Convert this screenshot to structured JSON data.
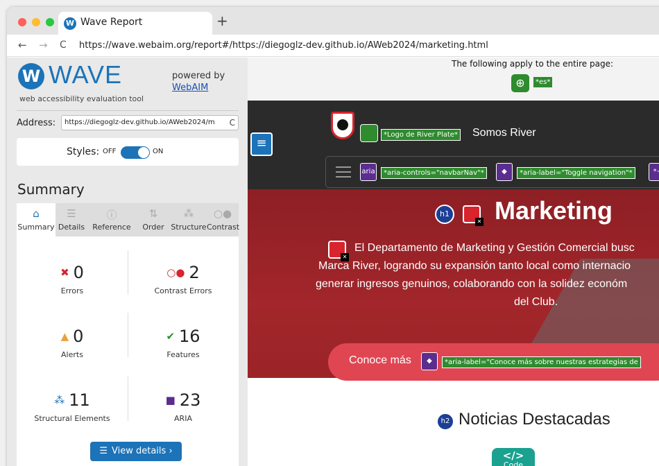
{
  "browser": {
    "tab_title": "Wave Report",
    "tab_icon_letter": "W",
    "new_tab": "+",
    "url": "https://wave.webaim.org/report#/https://diegoglz-dev.github.io/AWeb2024/marketing.html",
    "back": "←",
    "forward": "→",
    "reload": "C"
  },
  "sidebar": {
    "logo_letter": "W",
    "logo_text": "WAVE",
    "tagline": "web accessibility evaluation tool",
    "powered_by": "powered by",
    "powered_link": "WebAIM",
    "address_label": "Address:",
    "address_value": "https://diegoglz-dev.github.io/AWeb2024/m",
    "reload_icon": "C",
    "styles_label": "Styles:",
    "styles_off": "OFF",
    "styles_on": "ON",
    "summary_heading": "Summary",
    "tabs": [
      {
        "label": "Summary",
        "icon": "home-icon",
        "glyph": "⌂"
      },
      {
        "label": "Details",
        "icon": "list-icon",
        "glyph": "☰"
      },
      {
        "label": "Reference",
        "icon": "info-icon",
        "glyph": "ⓘ"
      },
      {
        "label": "Order",
        "icon": "order-icon",
        "glyph": "⇅"
      },
      {
        "label": "Structure",
        "icon": "structure-icon",
        "glyph": "⁂"
      },
      {
        "label": "Contrast",
        "icon": "contrast-icon",
        "glyph": "○●"
      }
    ],
    "counts": {
      "errors": {
        "value": "0",
        "label": "Errors",
        "symbol": "✖"
      },
      "contrast": {
        "value": "2",
        "label": "Contrast Errors",
        "symbol": "○●"
      },
      "alerts": {
        "value": "0",
        "label": "Alerts",
        "symbol": "▲"
      },
      "features": {
        "value": "16",
        "label": "Features",
        "symbol": "✔"
      },
      "structural": {
        "value": "11",
        "label": "Structural Elements",
        "symbol": "⁂"
      },
      "aria": {
        "value": "23",
        "label": "ARIA",
        "symbol": "■"
      }
    },
    "view_details": "View details ›"
  },
  "webpage": {
    "apply_text": "The following apply to the entire page:",
    "lang_tag": "*es*",
    "globe_glyph": "⊕",
    "logo_alt": "*Logo de River Plate*",
    "brand": "Somos River",
    "aria_badge": "aria",
    "aria_controls": "*aria-controls=\"navbarNav\"*",
    "aria_label_toggle": "*aria-label=\"Toggle navigation\"*",
    "aria_partial": "*+/",
    "h1_badge": "h1",
    "title": "Marketing",
    "paragraph_line1": "El Departamento de Marketing y Gestión Comercial busc",
    "paragraph_line2": "Marca River, logrando su expansión tanto local como internacio",
    "paragraph_line3": "generar ingresos genuinos, colaborando con la solidez económ",
    "paragraph_line4": "del Club.",
    "cta_text": "Conoce más",
    "cta_aria": "*aria-label=\"Conoce más sobre nuestras estrategias de",
    "h2_badge": "h2",
    "section_title": "Noticias Destacadas",
    "code_glyph": "</>",
    "code_label": "Code"
  },
  "colors": {
    "wave_blue": "#1c73b8",
    "feature_green": "#2e8b2e",
    "aria_purple": "#5b2d8e",
    "error_red": "#d9232d",
    "alert_orange": "#e8a33d"
  }
}
